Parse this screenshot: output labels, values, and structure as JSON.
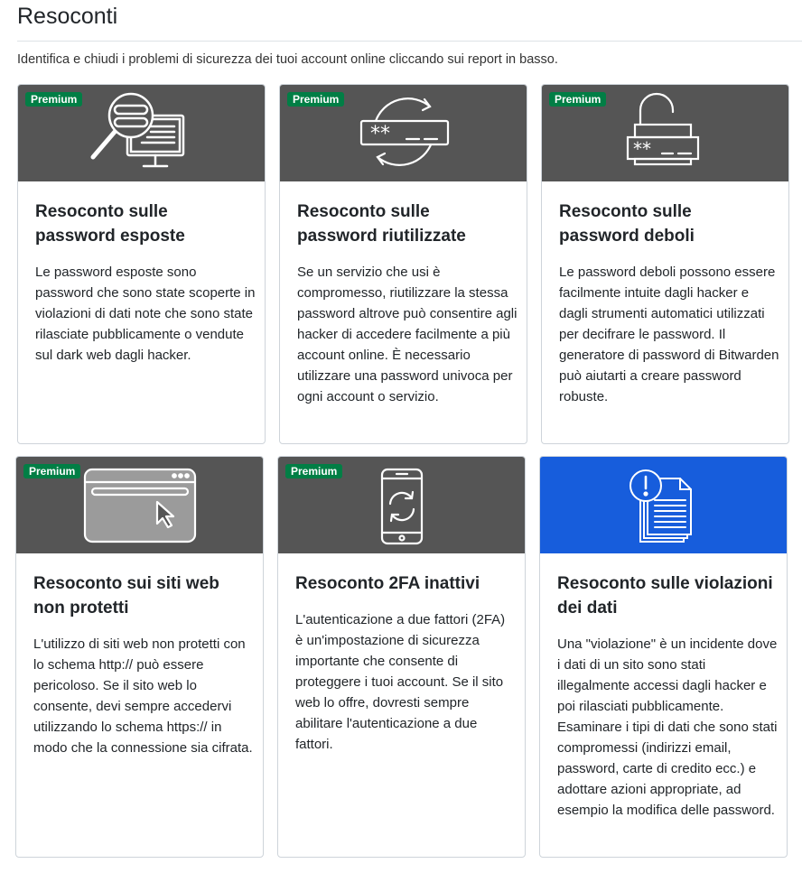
{
  "page": {
    "title": "Resoconti",
    "intro": "Identifica e chiudi i problemi di sicurezza dei tuoi account online cliccando sui report in basso."
  },
  "colors": {
    "header_gray": "#555555",
    "header_blue": "#175ddc",
    "premium_badge": "#017e45"
  },
  "reports": [
    {
      "badge": "Premium",
      "icon": "magnifier-monitor-icon",
      "title": "Resoconto sulle password esposte",
      "text": "Le password esposte sono password che sono state scoperte in violazioni di dati note che sono state rilasciate pubblicamente o vendute sul dark web dagli hacker."
    },
    {
      "badge": "Premium",
      "icon": "reused-password-icon",
      "title": "Resoconto sulle password riutilizzate",
      "text": "Se un servizio che usi è compromesso, riutilizzare la stessa password altrove può consentire agli hacker di accedere facilmente a più account online. È necessario utilizzare una password univoca per ogni account o servizio."
    },
    {
      "badge": "Premium",
      "icon": "weak-password-lock-icon",
      "title": "Resoconto sulle password deboli",
      "text": "Le password deboli possono essere facilmente intuite dagli hacker e dagli strumenti automatici utilizzati per decifrare le password. Il generatore di password di Bitwarden può aiutarti a creare password robuste."
    },
    {
      "badge": "Premium",
      "icon": "browser-cursor-icon",
      "title": "Resoconto sui siti web non protetti",
      "text": "L'utilizzo di siti web non protetti con lo schema http:// può essere pericoloso. Se il sito web lo consente, devi sempre accedervi utilizzando lo schema https:// in modo che la connessione sia cifrata."
    },
    {
      "badge": "Premium",
      "icon": "phone-sync-icon",
      "title": "Resoconto 2FA inattivi",
      "text": "L'autenticazione a due fattori (2FA) è un'impostazione di sicurezza importante che consente di proteggere i tuoi account. Se il sito web lo offre, dovresti sempre abilitare l'autenticazione a due fattori."
    },
    {
      "badge": "",
      "icon": "breach-documents-icon",
      "title": "Resoconto sulle violazioni dei dati",
      "text": "Una \"violazione\" è un incidente dove i dati di un sito sono stati illegalmente accessi dagli hacker e poi rilasciati pubblicamente. Esaminare i tipi di dati che sono stati compromessi (indirizzi email, password, carte di credito ecc.) e adottare azioni appropriate, ad esempio la modifica delle password."
    }
  ]
}
